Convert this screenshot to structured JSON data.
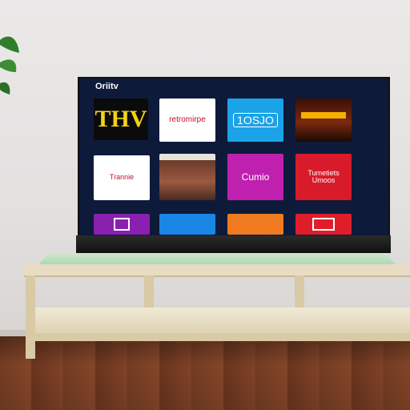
{
  "scene": {
    "tv_brand_text": "Oriitv",
    "tiles": [
      {
        "label": "THV",
        "bg": "#0b0b0b",
        "fg": "#f2d21a"
      },
      {
        "label": "retromirpe",
        "bg": "#ffffff",
        "fg": "#c8102e"
      },
      {
        "label": "1OSJO",
        "bg": "#1aa3e6",
        "fg": "#ffffff"
      },
      {
        "label": "",
        "bg": "#5a1a0d",
        "fg": "#f4b000"
      },
      {
        "label": "Trannie",
        "bg": "#ffffff",
        "fg": "#c8102e"
      },
      {
        "label": "",
        "bg": "#6a3a2a",
        "fg": "#ffffff"
      },
      {
        "label": "Cumio",
        "bg": "#c020b0",
        "fg": "#ffffff"
      },
      {
        "label": "Tumetiets Umoos",
        "bg": "#d81b2a",
        "fg": "#ffffff"
      },
      {
        "label": "",
        "bg": "#8a20b0",
        "fg": "#ffffff"
      },
      {
        "label": "",
        "bg": "#1a86e6",
        "fg": "#ffffff"
      },
      {
        "label": "",
        "bg": "#f07a20",
        "fg": "#ffffff"
      },
      {
        "label": "",
        "bg": "#e01e2a",
        "fg": "#ffffff"
      }
    ]
  }
}
